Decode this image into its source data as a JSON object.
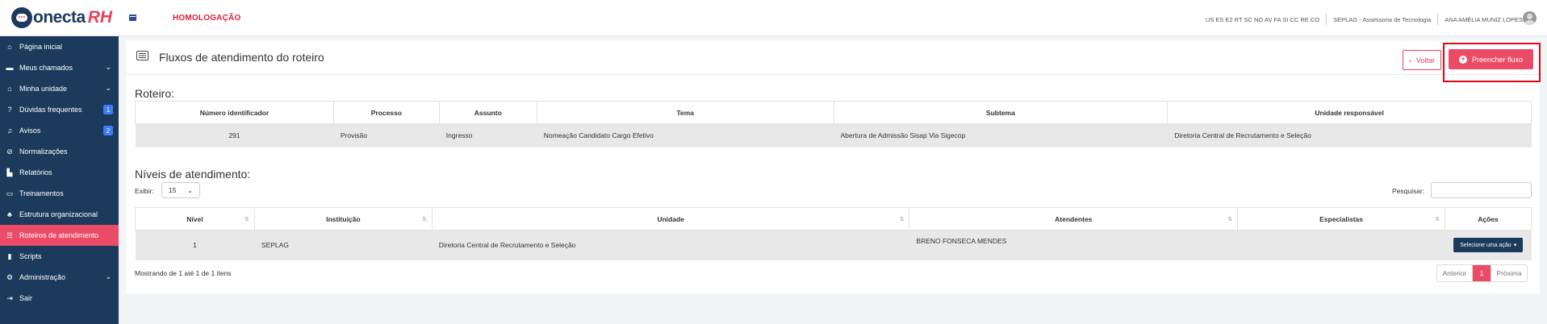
{
  "app": {
    "logo_text_1": "onecta",
    "logo_text_2": "RH",
    "environment": "HOMOLOGAÇÃO",
    "units_list": "US ES E2 RT SC NO AV FA SI CC RE CO",
    "org": "SEPLAG - Assessoria de Tecnologia",
    "user_name": "ANA AMÉLIA MUNIZ LOPES"
  },
  "sidebar": {
    "items": [
      {
        "label": "Página inicial",
        "icon": "home-icon"
      },
      {
        "label": "Meus chamados",
        "icon": "ticket-icon",
        "chevron": "⌄"
      },
      {
        "label": "Minha unidade",
        "icon": "home-icon",
        "chevron": "⌄"
      },
      {
        "label": "Dúvidas frequentes",
        "icon": "question-icon",
        "badge": "1"
      },
      {
        "label": "Avisos",
        "icon": "bell-icon",
        "badge": "2"
      },
      {
        "label": "Normalizações",
        "icon": "compass-icon"
      },
      {
        "label": "Relatórios",
        "icon": "chart-icon"
      },
      {
        "label": "Treinamentos",
        "icon": "training-icon"
      },
      {
        "label": "Estrutura organizacional",
        "icon": "sitemap-icon"
      },
      {
        "label": "Roteiros de atendimento",
        "icon": "list-icon"
      },
      {
        "label": "Scripts",
        "icon": "file-icon"
      },
      {
        "label": "Administração",
        "icon": "cogs-icon",
        "chevron": "⌄"
      },
      {
        "label": "Sair",
        "icon": "logout-icon"
      }
    ]
  },
  "page": {
    "title": "Fluxos de atendimento do roteiro",
    "back_label": "Voltar",
    "fill_label": "Preencher fluxo"
  },
  "roteiro": {
    "section_title": "Roteiro:",
    "headers": [
      "Número identificador",
      "Processo",
      "Assunto",
      "Tema",
      "Subtema",
      "Unidade responsável"
    ],
    "row": [
      "291",
      "Provisão",
      "Ingresso",
      "Nomeação Candidato Cargo Efetivo",
      "Abertura de Admissão Sisap Via Sigecop",
      "Diretoria Central de Recrutamento e Seleção"
    ]
  },
  "niveis": {
    "section_title": "Níveis de atendimento:",
    "show_label": "Exibir:",
    "show_value": "15",
    "search_label": "Pesquisar:",
    "search_value": "",
    "headers": [
      "Nível",
      "Instituição",
      "Unidade",
      "Atendentes",
      "Especialistas",
      "Ações"
    ],
    "rows": [
      {
        "nivel": "1",
        "instituicao": "SEPLAG",
        "unidade": "Diretoria Central de Recrutamento e Seleção",
        "atendentes": "BRENO FONSECA MENDES",
        "especialistas": "",
        "acao_label": "Selecione uma ação"
      }
    ],
    "info": "Mostrando de 1 até 1 de 1 itens",
    "pager_prev": "Anterior",
    "pager_current": "1",
    "pager_next": "Próxima"
  }
}
